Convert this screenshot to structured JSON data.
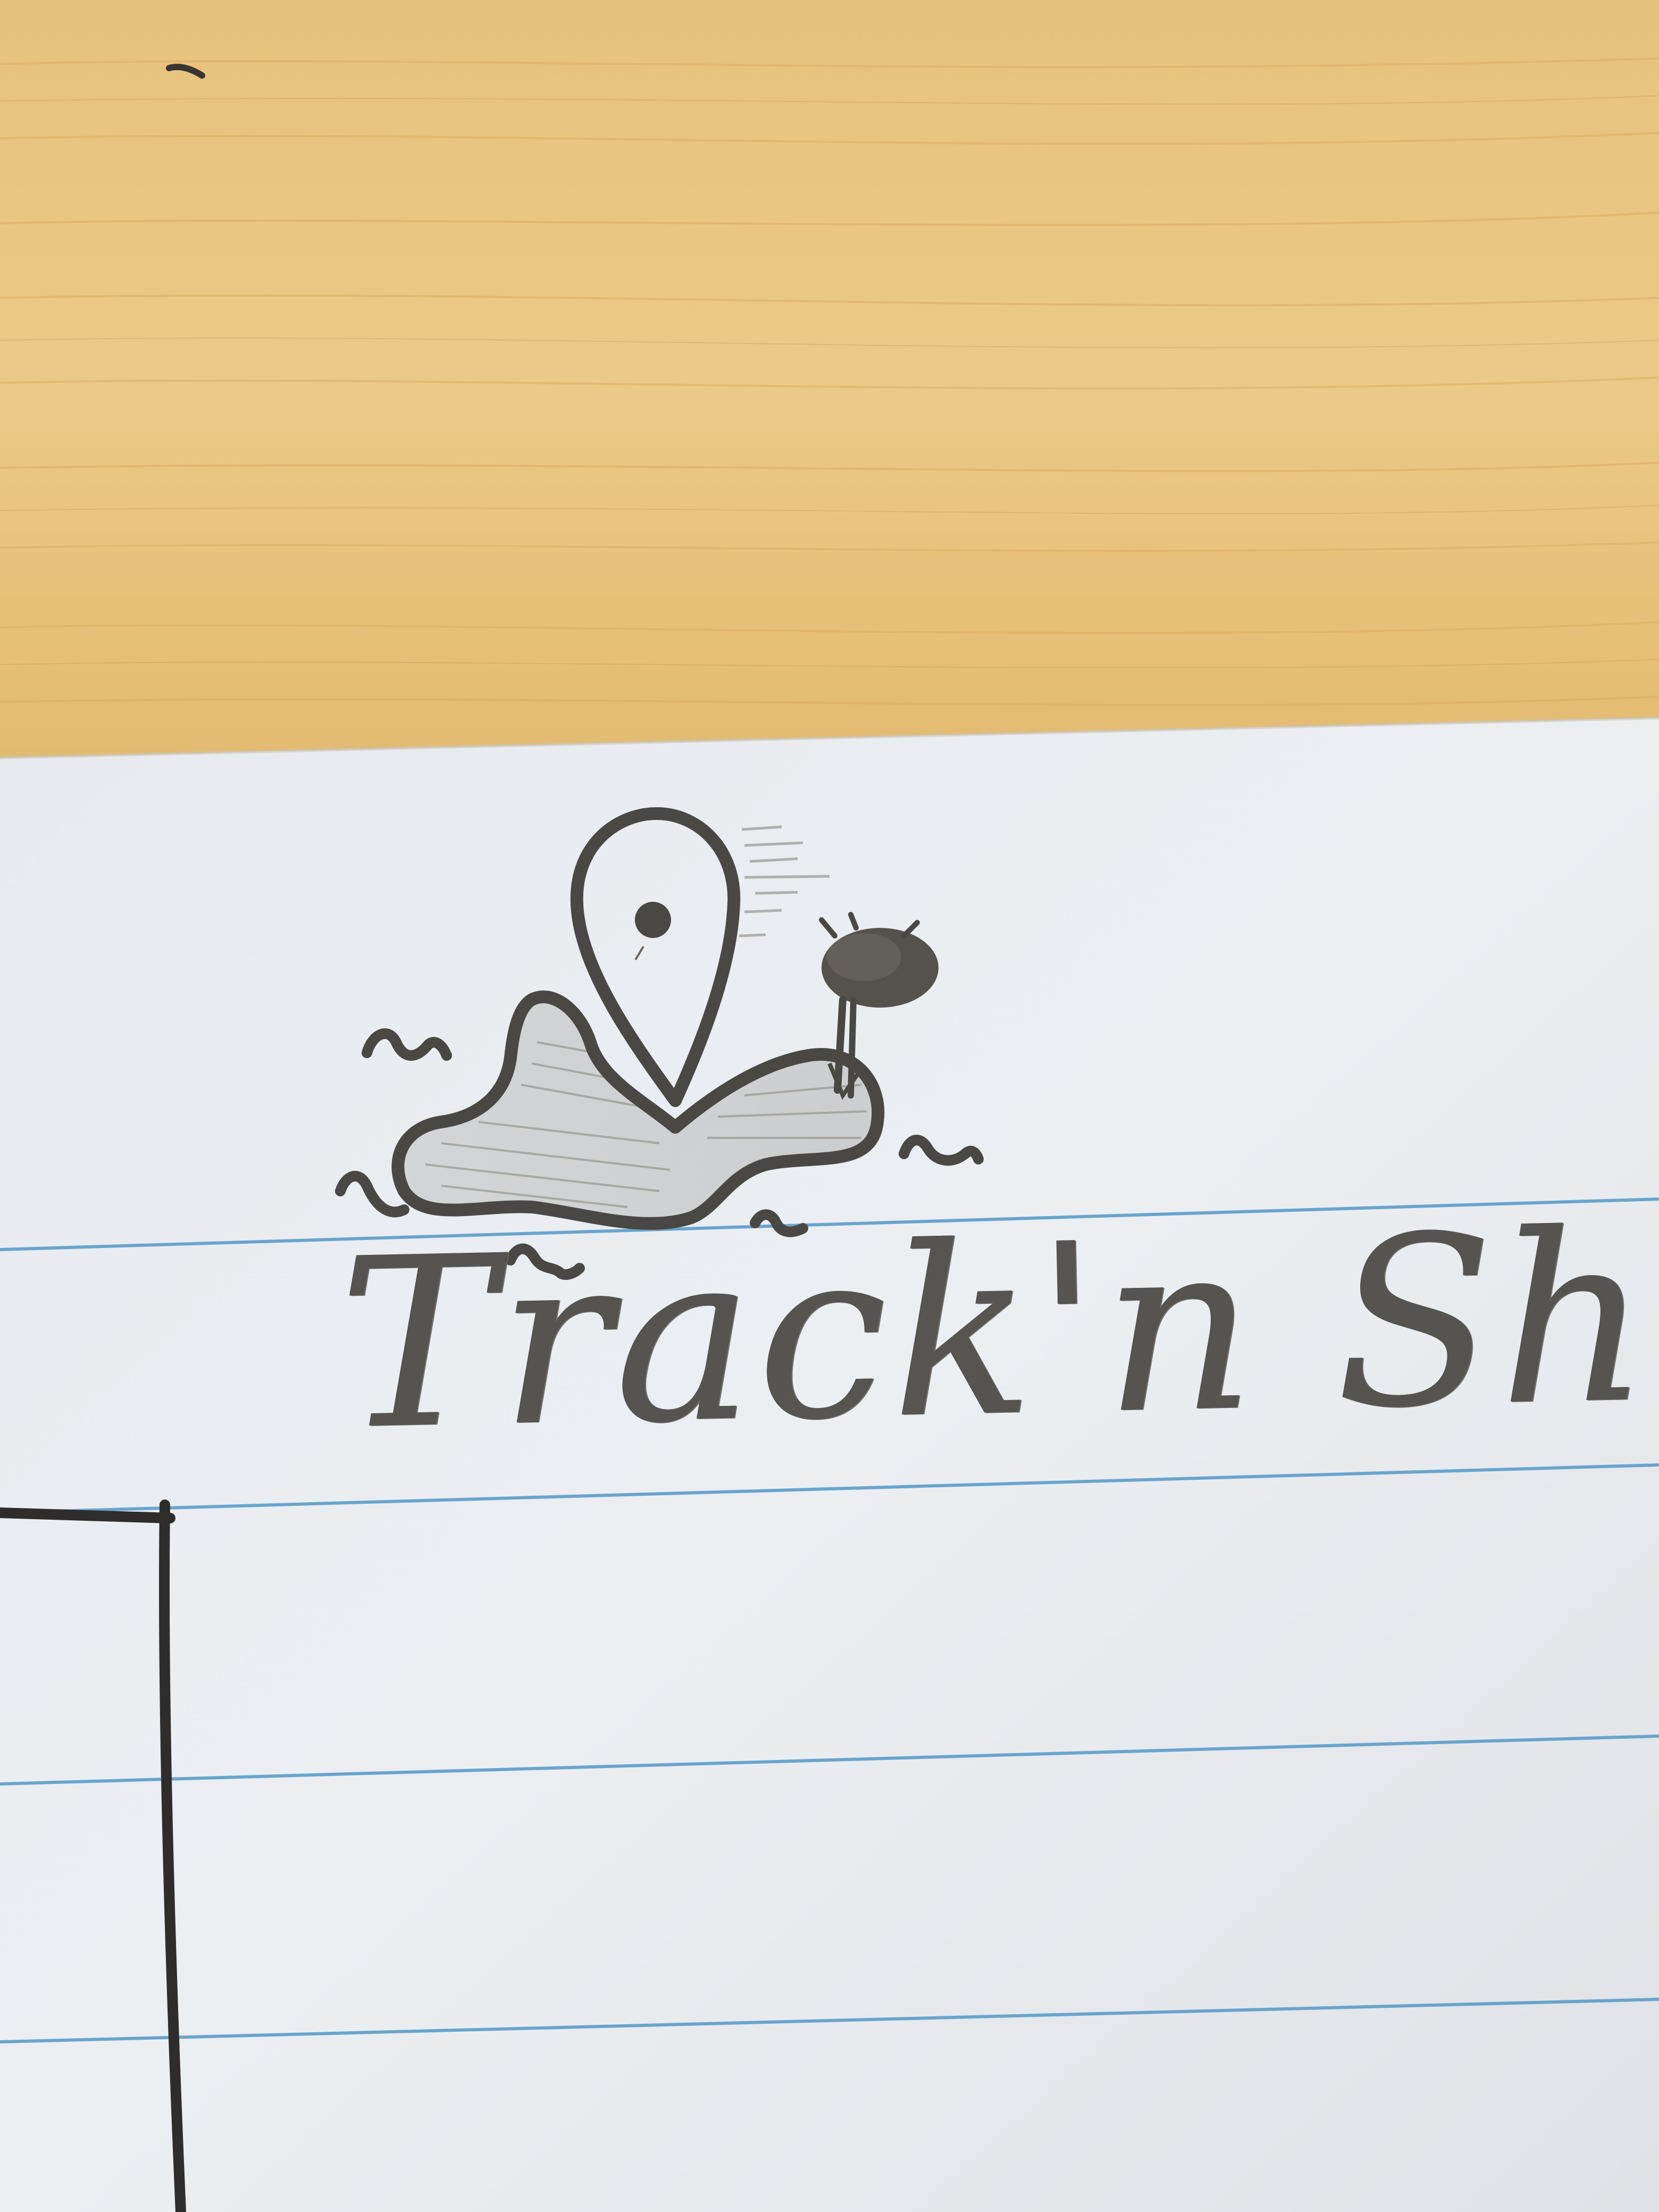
{
  "scene": {
    "kind": "pencil sketch on ruled notebook paper lying on a wooden desk",
    "colors": {
      "desk_base": "#e8c47a",
      "desk_grain": "#d9ad5f",
      "paper": "#e9ecf0",
      "paper_shade": "#dfe3e8",
      "ruled_line": "#5b9cc9",
      "pencil": "#4a4844",
      "pencil_shading": "#8a8782"
    }
  },
  "sketch": {
    "logo_wordmark": "Track'n Shore",
    "icons": [
      "map-pin-icon",
      "island-icon",
      "palm-tree-icon",
      "wave-icon"
    ]
  }
}
